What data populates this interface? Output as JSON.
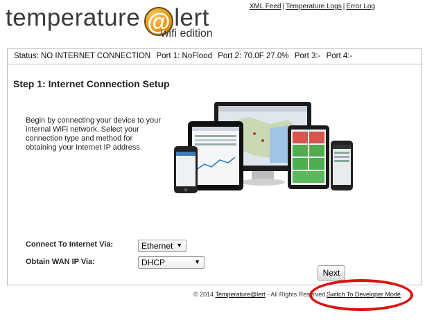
{
  "logo": {
    "part1": "temperature",
    "at": "@",
    "part2": "lert",
    "subtitle": "wifi edition"
  },
  "top_links": [
    "XML Feed",
    "Temperature Logs",
    "Error Log"
  ],
  "status_bar": {
    "status": "Status: NO INTERNET CONNECTION",
    "port1": "Port 1: NoFlood",
    "port2": "Port 2: 70.0F 27.0%",
    "port3": "Port 3:-",
    "port4": "Port 4:-"
  },
  "step": {
    "title": "Step 1: Internet Connection Setup",
    "intro": "Begin by connecting your device to your internal WiFi network. Select your connection type and method for obtaining your Internet IP address."
  },
  "form": {
    "connect_label": "Connect To Internet Via:",
    "connect_value": "Ethernet",
    "wan_label": "Obtain WAN IP Via:",
    "wan_value": "DHCP",
    "next_label": "Next"
  },
  "footer": {
    "copyright_prefix": "© 2014",
    "company": "Temperature@lert",
    "rights": "- All Rights Reserved.",
    "developer_mode": "Switch To Developer Mode"
  },
  "icons": {
    "dropdown": "triangle-down"
  },
  "colors": {
    "highlight_circle": "#e01010",
    "logo_orange": "#e59a1c"
  }
}
